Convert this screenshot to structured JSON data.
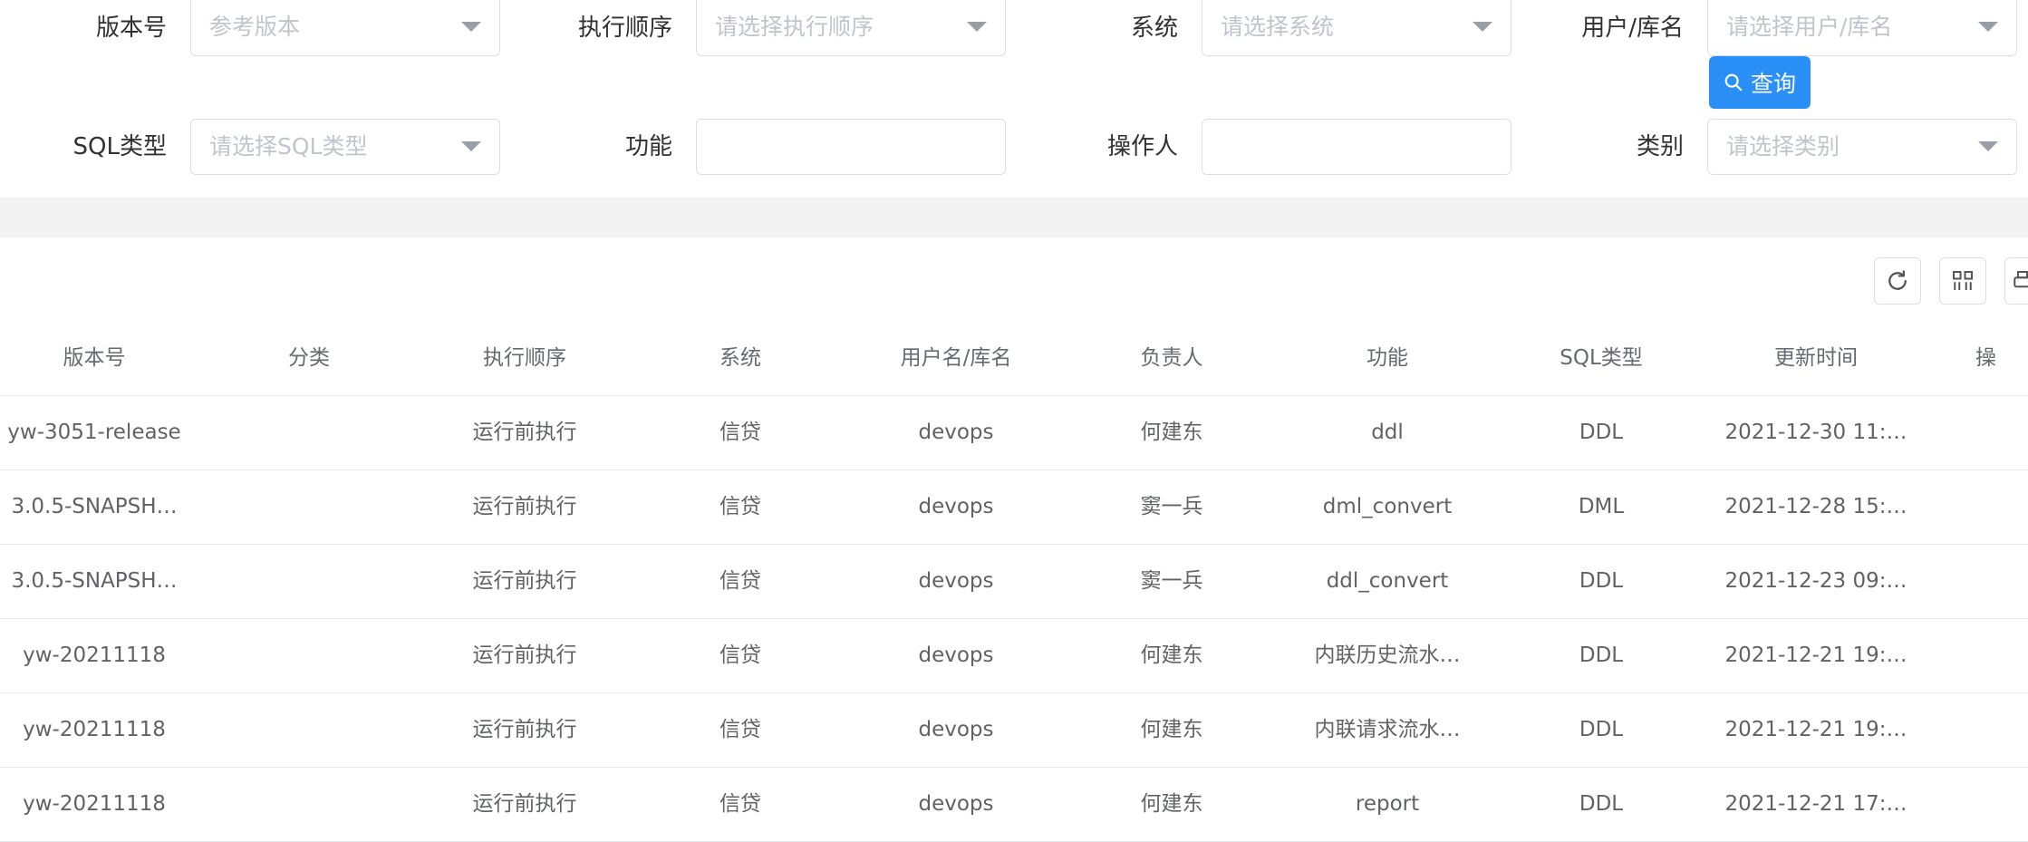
{
  "filters": {
    "version": {
      "label": "版本号",
      "placeholder": "参考版本"
    },
    "exec_order": {
      "label": "执行顺序",
      "placeholder": "请选择执行顺序"
    },
    "system": {
      "label": "系统",
      "placeholder": "请选择系统"
    },
    "user_db": {
      "label": "用户/库名",
      "placeholder": "请选择用户/库名"
    },
    "sql_type": {
      "label": "SQL类型",
      "placeholder": "请选择SQL类型"
    },
    "function": {
      "label": "功能",
      "value": ""
    },
    "operator": {
      "label": "操作人",
      "value": ""
    },
    "category": {
      "label": "类别",
      "placeholder": "请选择类别"
    },
    "query_label": "查询"
  },
  "toolbar": {
    "icons": [
      "refresh-icon",
      "columns-grid-icon",
      "print-icon"
    ]
  },
  "table": {
    "columns": [
      "版本号",
      "分类",
      "执行顺序",
      "系统",
      "用户名/库名",
      "负责人",
      "功能",
      "SQL类型",
      "更新时间",
      "操"
    ],
    "rows": [
      {
        "version": "yw-3051-release",
        "category": "",
        "exec_order": "运行前执行",
        "system": "信贷",
        "user_db": "devops",
        "owner": "何建东",
        "function": "ddl",
        "sql_type": "DDL",
        "updated": "2021-12-30 11:…"
      },
      {
        "version": "3.0.5-SNAPSH…",
        "category": "",
        "exec_order": "运行前执行",
        "system": "信贷",
        "user_db": "devops",
        "owner": "窦一兵",
        "function": "dml_convert",
        "sql_type": "DML",
        "updated": "2021-12-28 15:…"
      },
      {
        "version": "3.0.5-SNAPSH…",
        "category": "",
        "exec_order": "运行前执行",
        "system": "信贷",
        "user_db": "devops",
        "owner": "窦一兵",
        "function": "ddl_convert",
        "sql_type": "DDL",
        "updated": "2021-12-23 09:…"
      },
      {
        "version": "yw-20211118",
        "category": "",
        "exec_order": "运行前执行",
        "system": "信贷",
        "user_db": "devops",
        "owner": "何建东",
        "function": "内联历史流水…",
        "sql_type": "DDL",
        "updated": "2021-12-21 19:…"
      },
      {
        "version": "yw-20211118",
        "category": "",
        "exec_order": "运行前执行",
        "system": "信贷",
        "user_db": "devops",
        "owner": "何建东",
        "function": "内联请求流水…",
        "sql_type": "DDL",
        "updated": "2021-12-21 19:…"
      },
      {
        "version": "yw-20211118",
        "category": "",
        "exec_order": "运行前执行",
        "system": "信贷",
        "user_db": "devops",
        "owner": "何建东",
        "function": "report",
        "sql_type": "DDL",
        "updated": "2021-12-21 17:…"
      }
    ]
  },
  "colors": {
    "primary": "#2a8ff7",
    "placeholder": "#c0c4cc",
    "band": "#f3f3f3",
    "border": "#dcdfe6"
  }
}
